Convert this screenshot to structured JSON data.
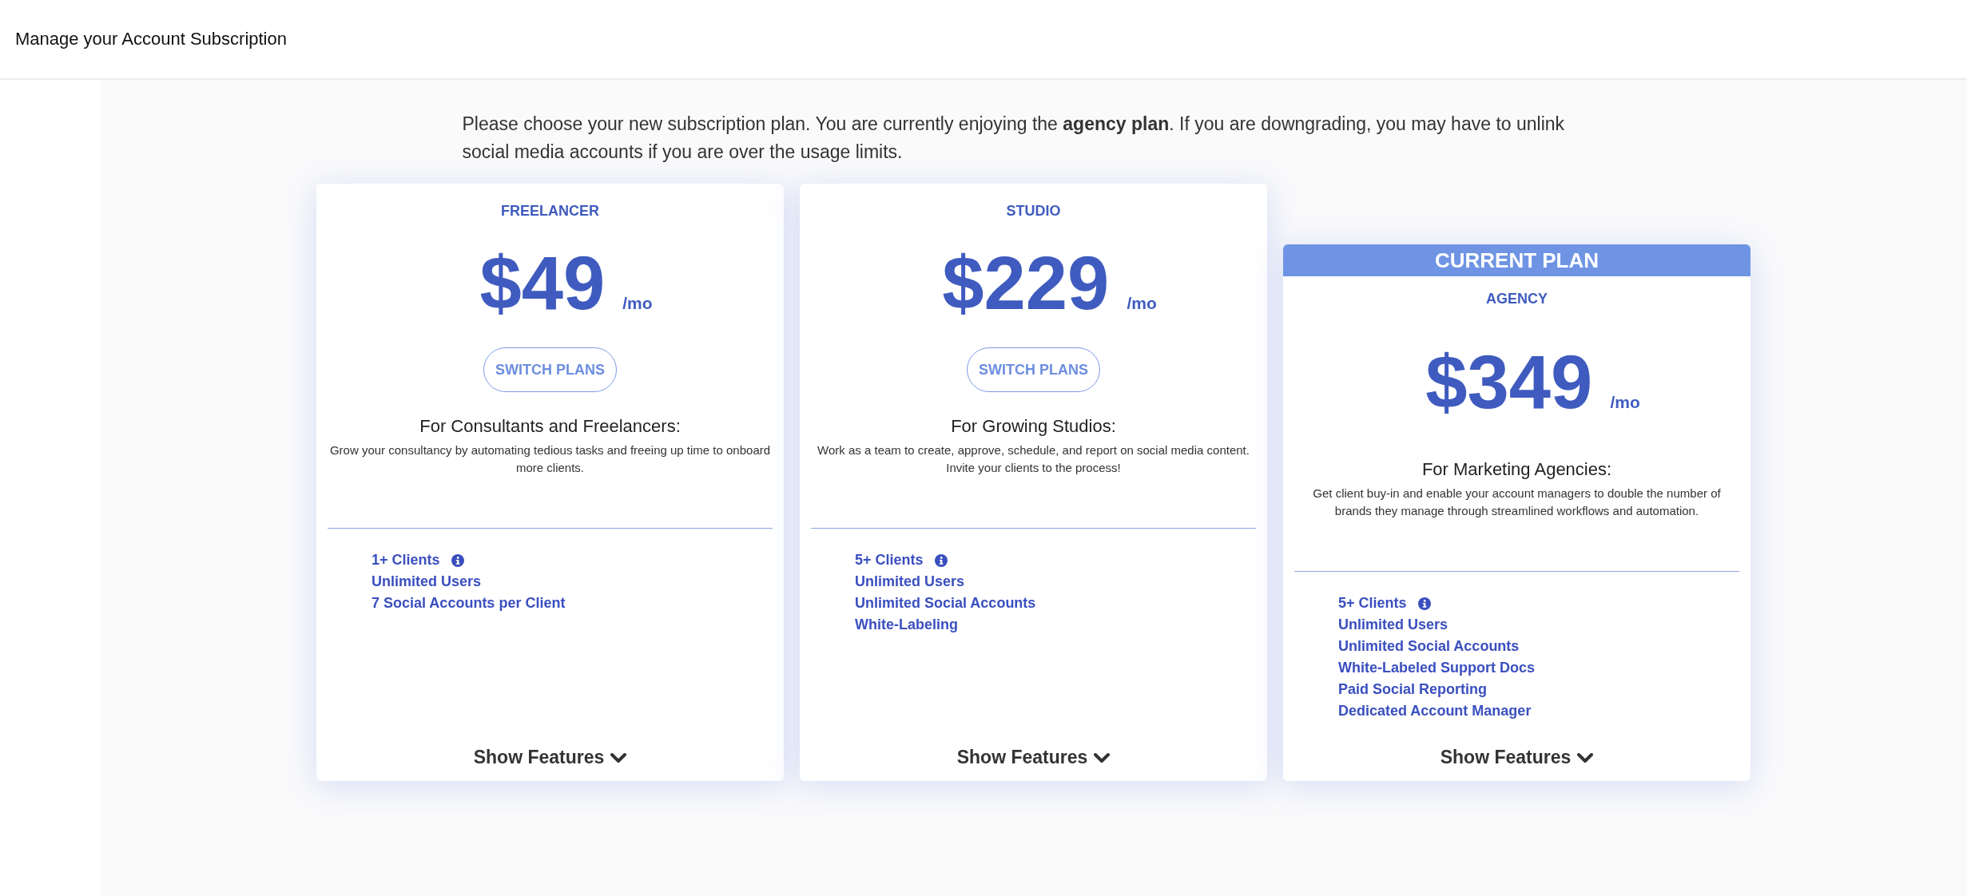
{
  "header": {
    "title": "Manage your Account Subscription"
  },
  "intro": "Please choose your new subscription plan. You are currently enjoying the **agency plan**. If you are downgrading, you may have to unlink social media accounts if you are over the usage limits.",
  "plans": [
    {
      "name": "FREELANCER",
      "price": "$49",
      "period": "/mo",
      "current": false,
      "button": "SWITCH PLANS",
      "tagline": "For Consultants and Freelancers:",
      "description": "Grow your consultancy by automating tedious tasks and freeing up time to onboard more clients.",
      "features": [
        {
          "label": "1+ Clients",
          "info": true
        },
        {
          "label": "Unlimited Users",
          "info": false
        },
        {
          "label": "7 Social Accounts per Client",
          "info": false
        }
      ],
      "toggle": "Show Features"
    },
    {
      "name": "STUDIO",
      "price": "$229",
      "period": "/mo",
      "current": false,
      "button": "SWITCH PLANS",
      "tagline": "For Growing Studios:",
      "description": "Work as a team to create, approve, schedule, and report on social media content. Invite your clients to the process!",
      "features": [
        {
          "label": "5+ Clients",
          "info": true
        },
        {
          "label": "Unlimited Users",
          "info": false
        },
        {
          "label": "Unlimited Social Accounts",
          "info": false
        },
        {
          "label": "White-Labeling",
          "info": false
        }
      ],
      "toggle": "Show Features"
    },
    {
      "name": "AGENCY",
      "price": "$349",
      "period": "/mo",
      "current": true,
      "banner": "CURRENT PLAN",
      "tagline": "For Marketing Agencies:",
      "description": "Get client buy-in and enable your account managers to double the number of brands they manage through streamlined workflows and automation.",
      "features": [
        {
          "label": "5+ Clients",
          "info": true
        },
        {
          "label": "Unlimited Users",
          "info": false
        },
        {
          "label": "Unlimited Social Accounts",
          "info": false
        },
        {
          "label": "White-Labeled Support Docs",
          "info": false
        },
        {
          "label": "Paid Social Reporting",
          "info": false
        },
        {
          "label": "Dedicated Account Manager",
          "info": false
        }
      ],
      "toggle": "Show Features"
    }
  ]
}
